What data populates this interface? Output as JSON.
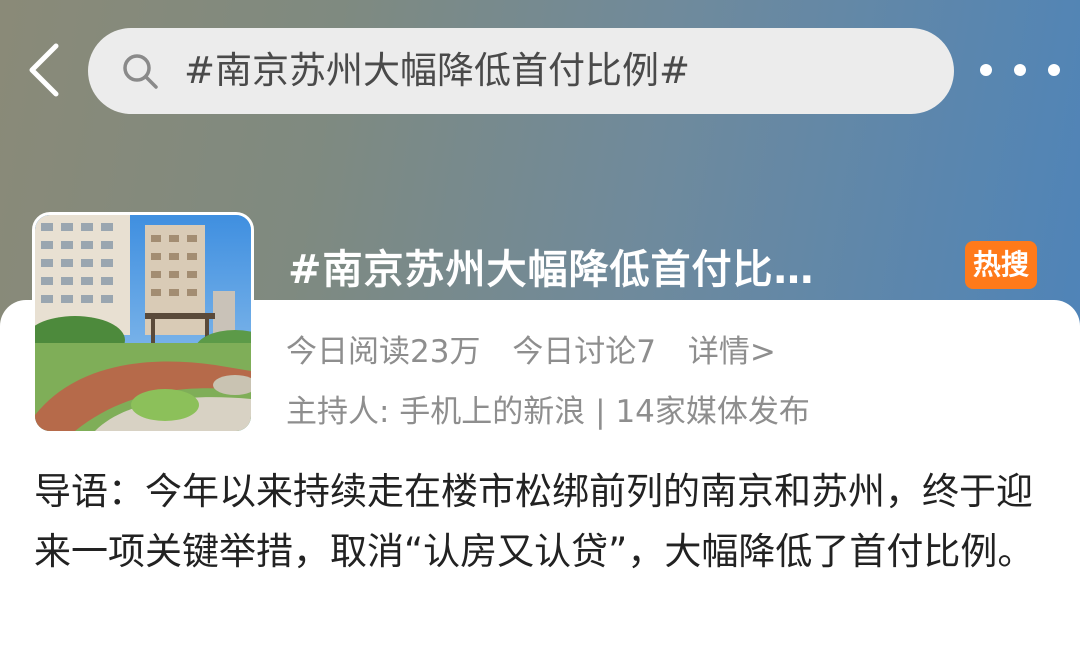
{
  "search": {
    "query": "#南京苏州大幅降低首付比例#"
  },
  "topic": {
    "title": "#南京苏州大幅降低首付比…",
    "badge": "热搜",
    "reads": "今日阅读23万",
    "discussions": "今日讨论7",
    "details_link": "详情>",
    "host": "主持人: 手机上的新浪 | 14家媒体发布"
  },
  "intro": {
    "text": "导语：今年以来持续走在楼市松绑前列的南京和苏州，终于迎来一项关键举措，取消“认房又认贷”，大幅降低了首付比例。"
  },
  "colors": {
    "badge_bg": "#ff7a1a",
    "header_gradient_start": "#8a8a78",
    "header_gradient_end": "#4f84b8",
    "muted_text": "#8e8e8e"
  },
  "icons": {
    "back": "chevron-left-icon",
    "search": "search-icon",
    "more": "more-dots-icon"
  }
}
